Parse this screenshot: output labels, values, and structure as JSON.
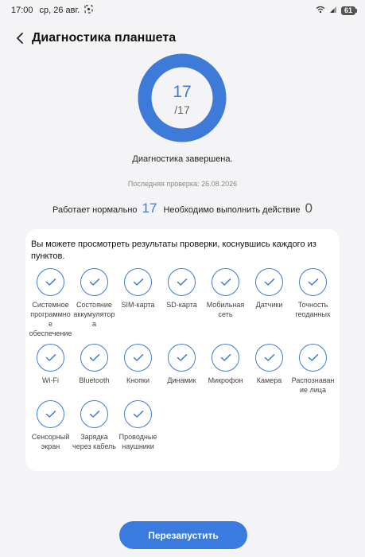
{
  "status_bar": {
    "time": "17:00",
    "date": "ср, 26 авг.",
    "battery": "61"
  },
  "header": {
    "back_icon": "chevron-left-icon",
    "title": "Диагностика планшета"
  },
  "progress": {
    "passed": "17",
    "total": "/17",
    "fraction": 1.0
  },
  "status_text": "Диагностика завершена.",
  "last_check": "Последняя проверка: 26.08.2026",
  "summary": {
    "ok_label": "Работает нормально",
    "ok_count": "17",
    "action_label": "Необходимо выполнить действие",
    "action_count": "0"
  },
  "card": {
    "description": "Вы можете просмотреть результаты проверки, коснувшись каждого из пунктов.",
    "items": [
      {
        "label": "Системное программное обеспечение"
      },
      {
        "label": "Состояние аккумулятора"
      },
      {
        "label": "SIM-карта"
      },
      {
        "label": "SD-карта"
      },
      {
        "label": "Мобильная сеть"
      },
      {
        "label": "Датчики"
      },
      {
        "label": "Точность геоданных"
      },
      {
        "label": "Wi-Fi"
      },
      {
        "label": "Bluetooth"
      },
      {
        "label": "Кнопки"
      },
      {
        "label": "Динамик"
      },
      {
        "label": "Микрофон"
      },
      {
        "label": "Камера"
      },
      {
        "label": "Распознавание лица"
      },
      {
        "label": "Сенсорный экран"
      },
      {
        "label": "Зарядка через кабель"
      },
      {
        "label": "Проводные наушники"
      }
    ]
  },
  "restart_label": "Перезапустить",
  "colors": {
    "accent": "#3e7bd9",
    "background": "#f4f4f6"
  }
}
